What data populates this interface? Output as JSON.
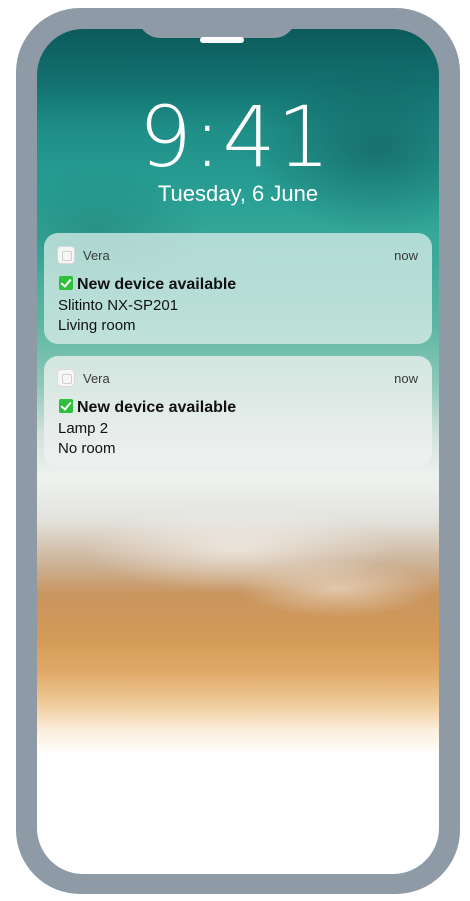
{
  "lockscreen": {
    "time": "9:41",
    "date": "Tuesday, 6 June"
  },
  "notifications": [
    {
      "app": "Vera",
      "timestamp": "now",
      "title": "New device available",
      "device": "Slitinto NX-SP201",
      "room": "Living room"
    },
    {
      "app": "Vera",
      "timestamp": "now",
      "title": "New device available",
      "device": "Lamp 2",
      "room": "No room"
    }
  ],
  "colors": {
    "frame": "#8e9aa6",
    "check": "#2fbf3b"
  },
  "icons": {
    "app": "vera-app-icon",
    "check": "check-mark-icon"
  }
}
